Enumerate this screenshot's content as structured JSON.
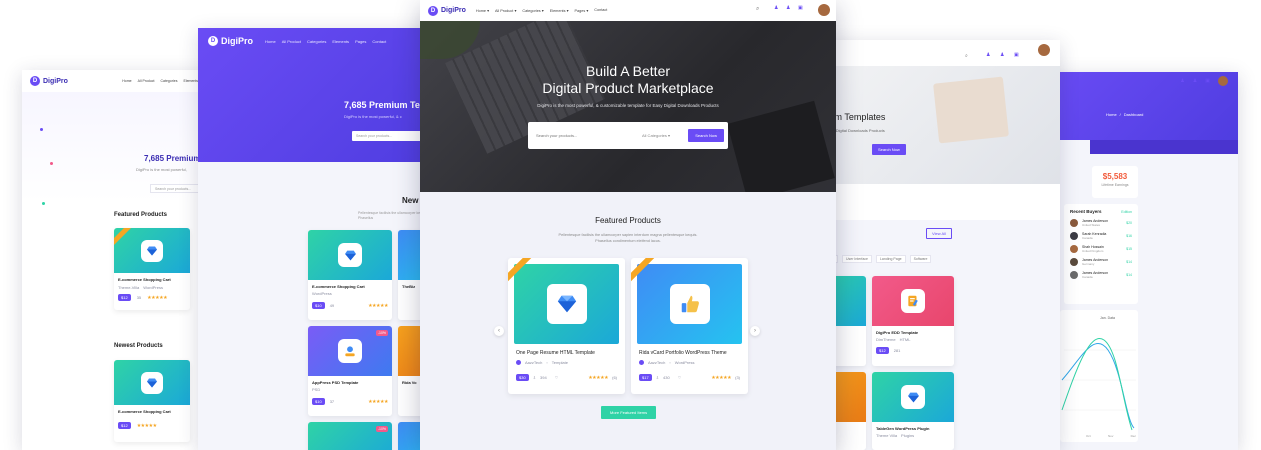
{
  "brand": {
    "name": "DigiPro",
    "colors": {
      "primary": "#6a4cf5",
      "accent": "#2fd3a6",
      "star": "#f5a623",
      "dark": "#2b2b2b"
    }
  },
  "nav": {
    "items": [
      "Home",
      "All Product",
      "Categories",
      "Elements",
      "Pages",
      "Contact"
    ]
  },
  "hero": {
    "title_line1": "Build A Better",
    "title_line2": "Digital Product Marketplace",
    "subtitle": "DigiPro is the most powerful, & customizable template for Easy Digital Downloads Products",
    "search_placeholder": "Search your products...",
    "category_select": "All Categories",
    "search_button": "Search Now"
  },
  "featured": {
    "title": "Featured Products",
    "description": "Pellentesque facilisis the ullamcorper sapien interdum magna pellentesque kequis. Phasellus condimentum eleifend lacus.",
    "more_button": "More Featured Items",
    "products": [
      {
        "name": "One Page Resume HTML Template",
        "author": "AazzTech",
        "category": "Template",
        "price": "$30",
        "sales": "394",
        "rating_count": "(6)",
        "icon": "diamond-icon"
      },
      {
        "name": "Rida vCard Portfolio WordPress Theme",
        "author": "AazzTech",
        "category": "WordPress",
        "price": "$17",
        "sales": "430",
        "rating_count": "(3)",
        "icon": "thumbs-up-icon"
      }
    ]
  },
  "left_far": {
    "headline": "7,685 Premium",
    "sub": "DigiPro is the most powerful,",
    "search_placeholder": "Search your products...",
    "featured_title": "Featured Products",
    "newest_title": "Newest Products",
    "card_name": "E-commerce Shopping Cart",
    "card_author": "Theme-Villa",
    "card_category": "WordPress",
    "card_price": "$12",
    "card_sales": "35"
  },
  "left_mid": {
    "headline": "7,685 Premium Templ",
    "sub": "DigiPro is the most powerful, & c",
    "search_placeholder": "Search your products...",
    "section_title": "New",
    "section_desc": "Pellentesque facilisis the ullamcorper kequis. Phasellus",
    "cards": [
      {
        "name": "E-commerce Shopping Cart",
        "category": "WordPress",
        "price": "$10",
        "sales": "49"
      },
      {
        "name": "AppPress PSD Template",
        "category": "PSD",
        "price": "$10",
        "sales": "37"
      }
    ],
    "badge": "-10%",
    "side_card_name": "TheBiz",
    "side_card_name_2": "Rida Vo"
  },
  "right_mid": {
    "headline": "mium Templates",
    "sub": "for Easy Digital Downloads Products",
    "search_button": "Search Now",
    "view_all": "View All",
    "filters": [
      "User Interface",
      "Landing Page",
      "Software"
    ],
    "cards": [
      {
        "name": "DigiPro EDD Template",
        "category": "HTML",
        "author": "DimTheme",
        "price": "$12",
        "sales": "281"
      },
      {
        "name": "TableGen WordPress Plugin",
        "category": "Plugins",
        "author": "Theme Villa"
      }
    ],
    "partial_label": "eme"
  },
  "right_far": {
    "breadcrumb_home": "Home",
    "breadcrumb_current": "Dashboard",
    "stat_value": "$5,583",
    "stat_label": "Lifetime Earnings",
    "buyers_title": "Recent Buyers",
    "buyers_filter": "Edition",
    "buyers": [
      {
        "name": "James Anderson",
        "country": "United States",
        "amount": "$20"
      },
      {
        "name": "Sarah Kenradia",
        "country": "Canada",
        "amount": "$16"
      },
      {
        "name": "Shah Hossain",
        "country": "United Kingdom",
        "amount": "$15"
      },
      {
        "name": "James Anderson",
        "country": "Germany",
        "amount": "$14"
      },
      {
        "name": "James Anderson",
        "country": "Canada",
        "amount": "$14"
      }
    ],
    "chart_month": "Jan. Data",
    "chart_xlabels": [
      "Oct",
      "Nov",
      "Dec"
    ]
  }
}
